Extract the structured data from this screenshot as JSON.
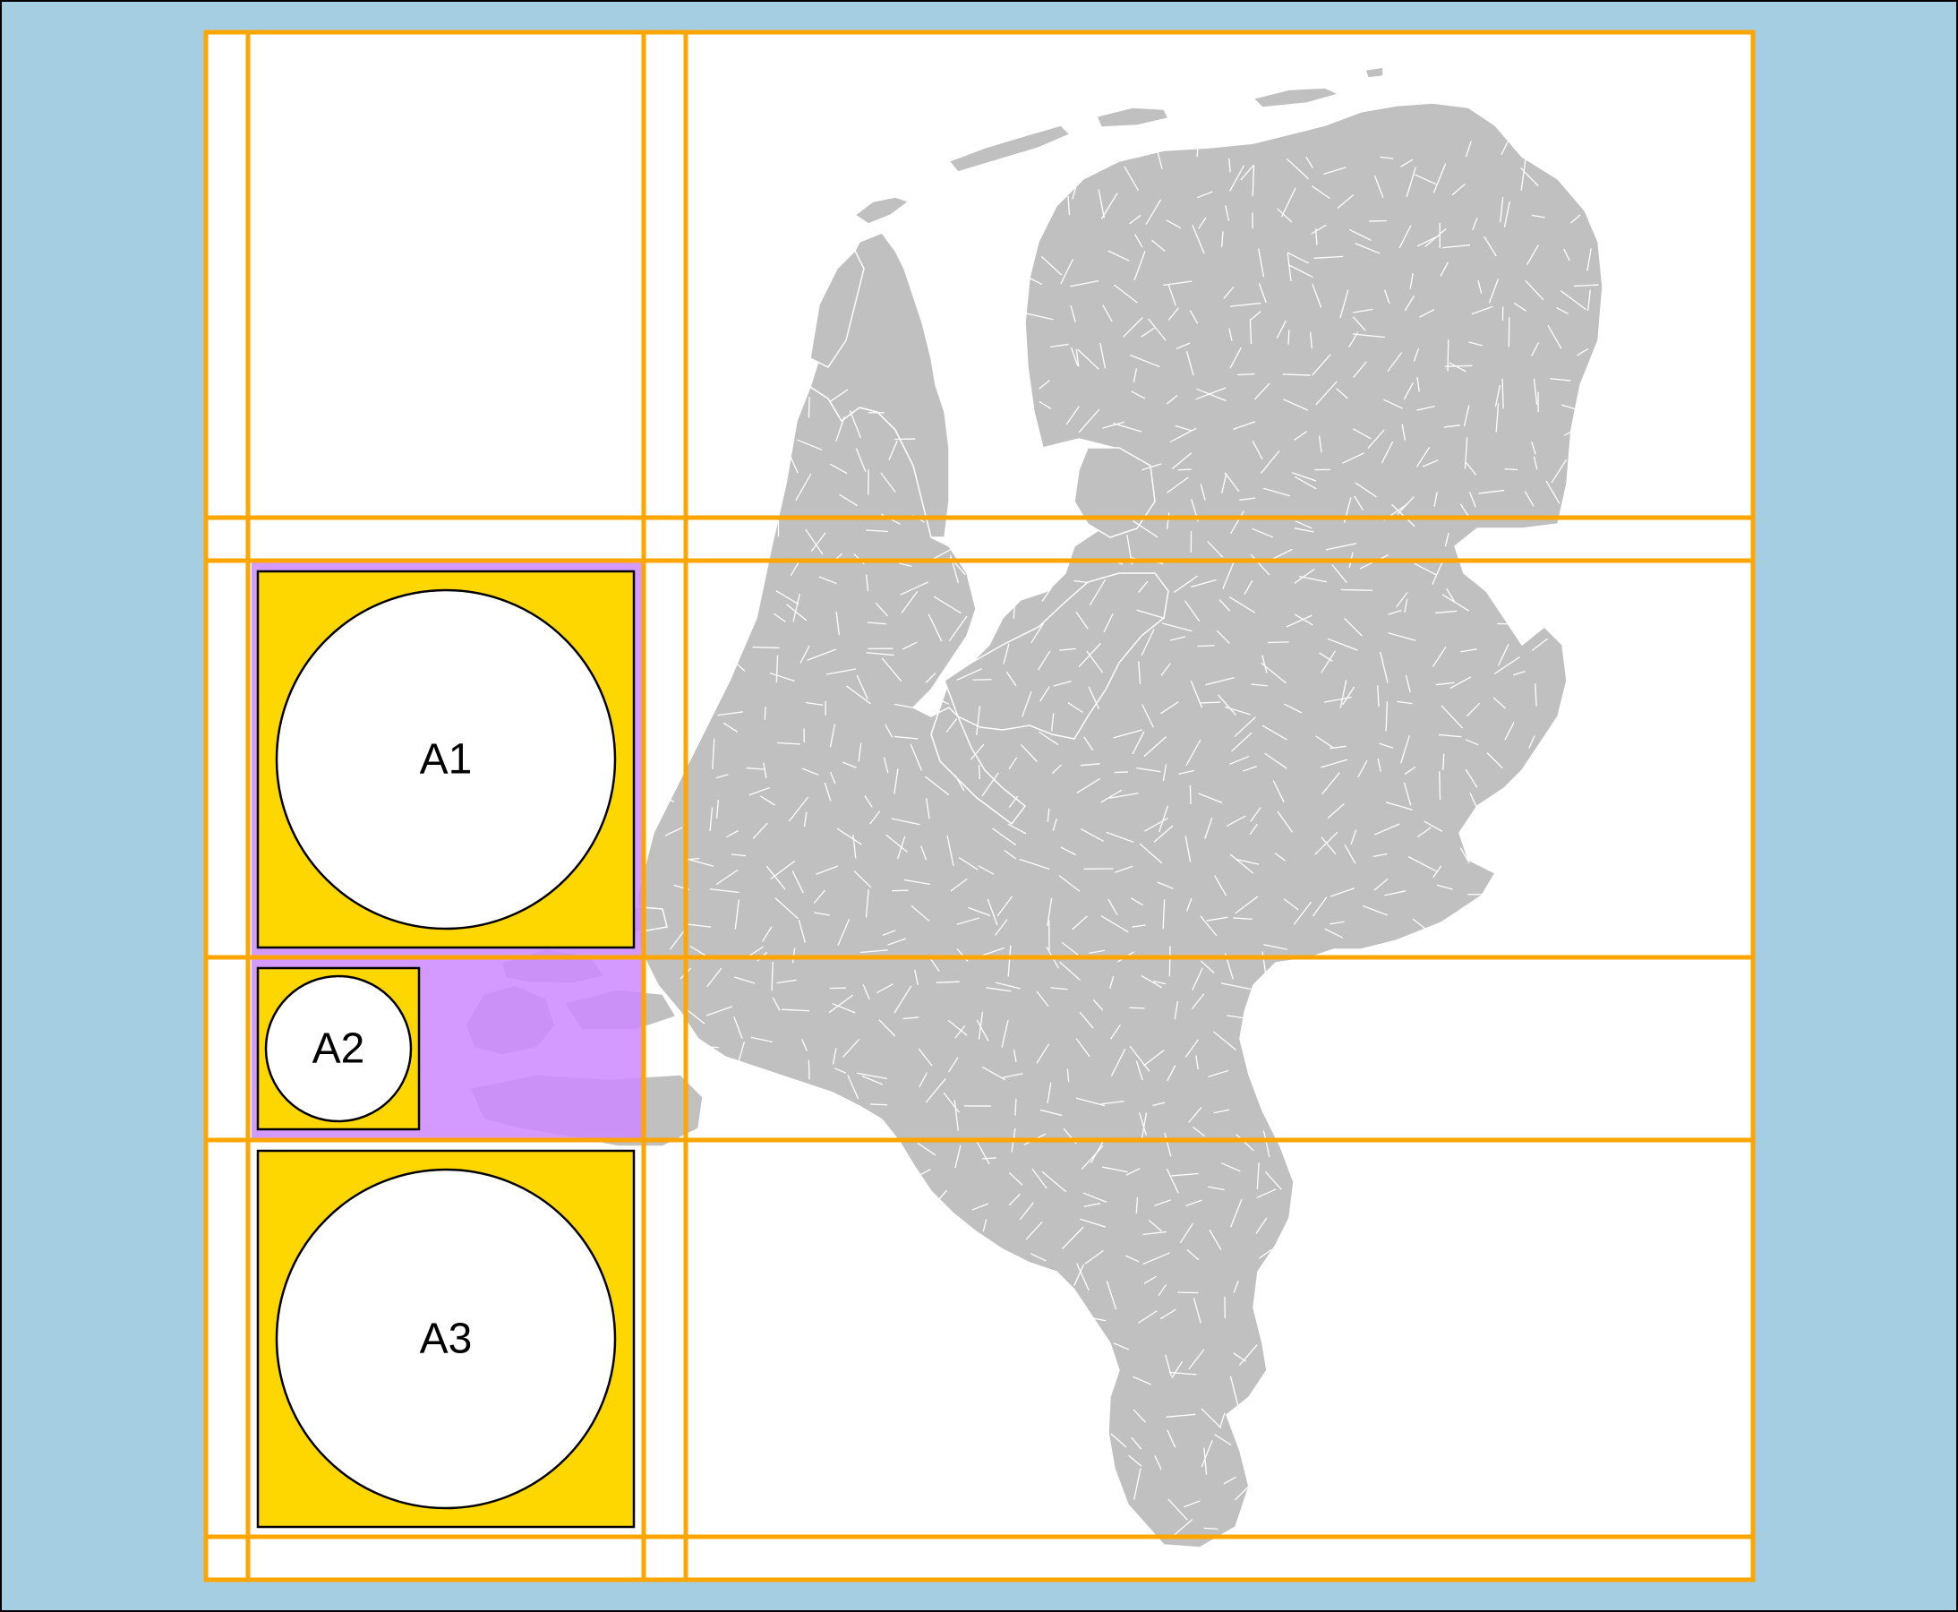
{
  "colors": {
    "sea": "#a6cee3",
    "frame_background": "#ffffff",
    "land": "#c0c0c0",
    "municipality_border": "#ffffff",
    "grid_lines": "#ffa500",
    "highlight_column": "#cc88ff",
    "panel_fill": "#ffd700",
    "circle_fill": "#ffffff",
    "outline": "#000000"
  },
  "map": {
    "country": "Netherlands",
    "layer": "municipalities"
  },
  "grid": {
    "rows": 4,
    "columns": 2,
    "highlighted_column": 1
  },
  "panels": [
    {
      "id": "A1",
      "label": "A1",
      "size": "large"
    },
    {
      "id": "A2",
      "label": "A2",
      "size": "small"
    },
    {
      "id": "A3",
      "label": "A3",
      "size": "large"
    }
  ]
}
